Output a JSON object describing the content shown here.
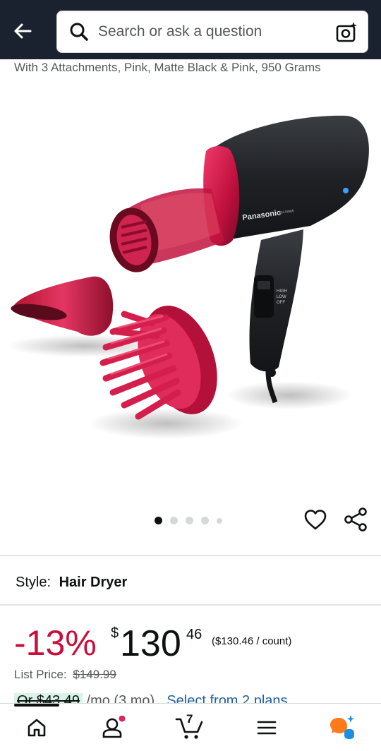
{
  "header": {
    "search_placeholder": "Search or ask a question"
  },
  "product": {
    "subtitle": "With 3 Attachments, Pink, Matte Black & Pink, 950 Grams",
    "brand_on_image": "Panasonic",
    "model_on_image": "EH-NA65",
    "switch_labels": [
      "HIGH",
      "LOW",
      "OFF"
    ]
  },
  "gallery": {
    "dots_total": 5,
    "active_index": 0
  },
  "style": {
    "label": "Style:",
    "value": "Hair Dryer"
  },
  "price": {
    "discount": "-13%",
    "currency": "$",
    "whole": "130",
    "fraction": "46",
    "unit_price": "($130.46 / count)",
    "list_label": "List Price:",
    "list_value": "$149.99",
    "installment_prefix": "Or $43.49",
    "installment_mid": "/mo (3 mo).",
    "installment_link": "Select from 2 plans"
  },
  "bottom_nav": {
    "cart_count": "7",
    "items": [
      "home-icon",
      "account-icon",
      "cart-icon",
      "menu-icon",
      "rufus-icon"
    ]
  },
  "colors": {
    "topbar": "#1a2230",
    "discount_red": "#cc0c39",
    "link_blue": "#2162a1",
    "notification_pink": "#e0245e"
  }
}
